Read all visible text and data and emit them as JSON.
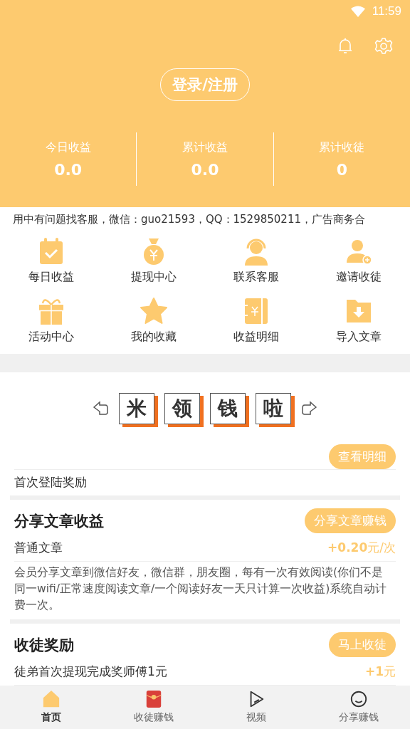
{
  "status_bar": {
    "time": "11:59"
  },
  "header": {
    "login_button": "登录/注册",
    "stats": [
      {
        "label": "今日收益",
        "value": "0.0"
      },
      {
        "label": "累计收益",
        "value": "0.0"
      },
      {
        "label": "累计收徒",
        "value": "0"
      }
    ]
  },
  "notice": "用中有问题找客服，微信：guo21593，QQ：1529850211，广告商务合",
  "shortcuts": [
    {
      "kind": "calendar",
      "label": "每日收益"
    },
    {
      "kind": "moneybag",
      "label": "提现中心"
    },
    {
      "kind": "headset",
      "label": "联系客服"
    },
    {
      "kind": "adduser",
      "label": "邀请收徒"
    },
    {
      "kind": "gift",
      "label": "活动中心"
    },
    {
      "kind": "star",
      "label": "我的收藏"
    },
    {
      "kind": "ledger",
      "label": "收益明细"
    },
    {
      "kind": "folder",
      "label": "导入文章"
    }
  ],
  "banner": {
    "chars": [
      "米",
      "领",
      "钱",
      "啦"
    ]
  },
  "first_login": {
    "button": "查看明细",
    "label": "首次登陆奖励"
  },
  "share": {
    "title": "分享文章收益",
    "button": "分享文章赚钱",
    "item": "普通文章",
    "reward": "+0.20",
    "unit": "元/次",
    "description": "会员分享文章到微信好友，微信群，朋友圈，每有一次有效阅读(你们不是同一wifi/正常速度阅读文章/一个阅读好友一天只计算一次收益)系统自动计费一次。"
  },
  "recruit": {
    "title": "收徒奖励",
    "button": "马上收徒",
    "item": "徒弟首次提现完成奖师傅1元",
    "reward": "+1",
    "unit": "元"
  },
  "tabs": [
    {
      "kind": "home",
      "label": "首页",
      "selected": true
    },
    {
      "kind": "envelope",
      "label": "收徒赚钱",
      "selected": false
    },
    {
      "kind": "play",
      "label": "视频",
      "selected": false
    },
    {
      "kind": "face",
      "label": "分享赚钱",
      "selected": false
    }
  ]
}
